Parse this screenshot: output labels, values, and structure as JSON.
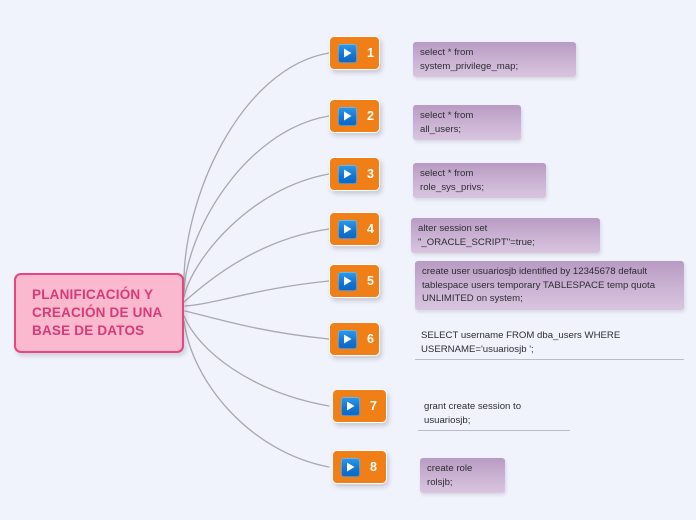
{
  "diagram": {
    "type": "mindmap",
    "title": "PLANIFICACIÓN Y CREACIÓN DE UNA BASE DE DATOS",
    "background_color": "#f0f2fc",
    "root": {
      "label": "PLANIFICACIÓN Y\nCREACIÓN DE UNA\nBASE DE DATOS",
      "fill_color": "#fbb9cf",
      "border_color": "#e7477f",
      "text_color": "#d63a77"
    },
    "branch_style": {
      "fill_color": "#ef7f16",
      "icon": "play-icon",
      "icon_color": "#1276d4"
    },
    "branches": [
      {
        "number": "1",
        "icon": "play-icon",
        "label": "select * from system_privilege_map;",
        "label_style": "pill"
      },
      {
        "number": "2",
        "icon": "play-icon",
        "label": "select * from all_users;",
        "label_style": "pill"
      },
      {
        "number": "3",
        "icon": "play-icon",
        "label": "select * from  role_sys_privs;",
        "label_style": "pill"
      },
      {
        "number": "4",
        "icon": "play-icon",
        "label": "alter session set \"_ORACLE_SCRIPT\"=true;",
        "label_style": "pill"
      },
      {
        "number": "5",
        "icon": "play-icon",
        "label": "create user usuariosjb identified by 12345678 default\ntablespace users temporary TABLESPACE temp quota\nUNLIMITED on system;",
        "label_style": "pill"
      },
      {
        "number": "6",
        "icon": "play-icon",
        "label": "SELECT username FROM dba_users WHERE\nUSERNAME='usuariosjb ';",
        "label_style": "plain"
      },
      {
        "number": "7",
        "icon": "play-icon",
        "label": "grant create session to usuariosjb;",
        "label_style": "plain"
      },
      {
        "number": "8",
        "icon": "play-icon",
        "label": "create role rolsjb;",
        "label_style": "pill"
      }
    ]
  }
}
